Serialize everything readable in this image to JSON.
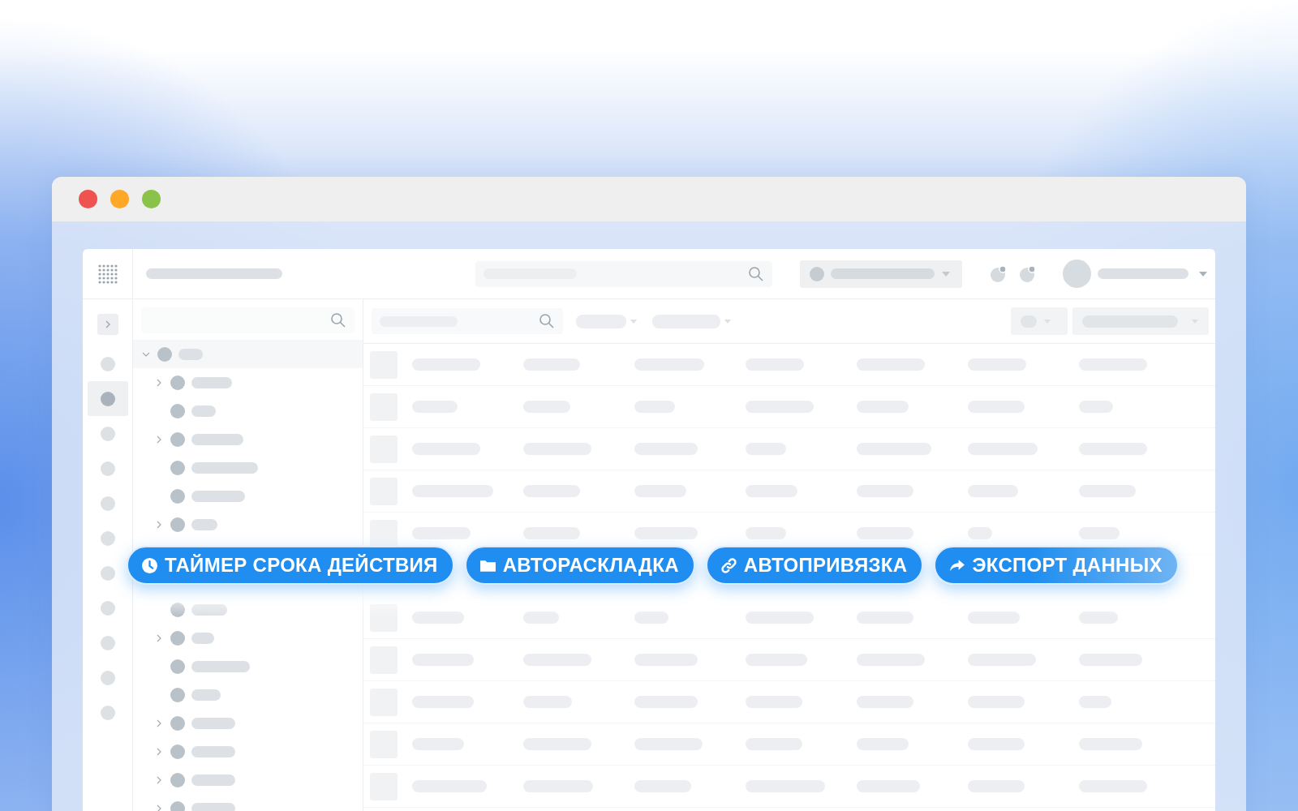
{
  "rail": {
    "items": [
      {
        "selected": false
      },
      {
        "selected": true
      },
      {
        "selected": false
      },
      {
        "selected": false
      },
      {
        "selected": false
      },
      {
        "selected": false
      },
      {
        "selected": false
      },
      {
        "selected": false
      },
      {
        "selected": false
      },
      {
        "selected": false
      },
      {
        "selected": false
      }
    ]
  },
  "tree": {
    "expanded": true,
    "children": [
      {
        "expanded": false
      },
      {
        "kind": "leaf"
      },
      {
        "expanded": false
      },
      {
        "kind": "leaf"
      },
      {
        "kind": "leaf"
      },
      {
        "expanded": false
      },
      {
        "kind": "gap"
      },
      {
        "kind": "leaf"
      },
      {
        "expanded": false
      },
      {
        "kind": "leaf"
      },
      {
        "kind": "leaf"
      },
      {
        "expanded": false
      },
      {
        "expanded": false
      },
      {
        "expanded": false
      },
      {
        "expanded": false
      }
    ]
  },
  "features": [
    {
      "kind": "timer",
      "label": "ТАЙМЕР СРОКА ДЕЙСТВИЯ"
    },
    {
      "kind": "folder",
      "label": "АВТОРАСКЛАДКА"
    },
    {
      "kind": "link",
      "label": "АВТОПРИВЯЗКА"
    },
    {
      "kind": "share",
      "label": "ЭКСПОРТ ДАННЫХ",
      "faded": true
    }
  ]
}
